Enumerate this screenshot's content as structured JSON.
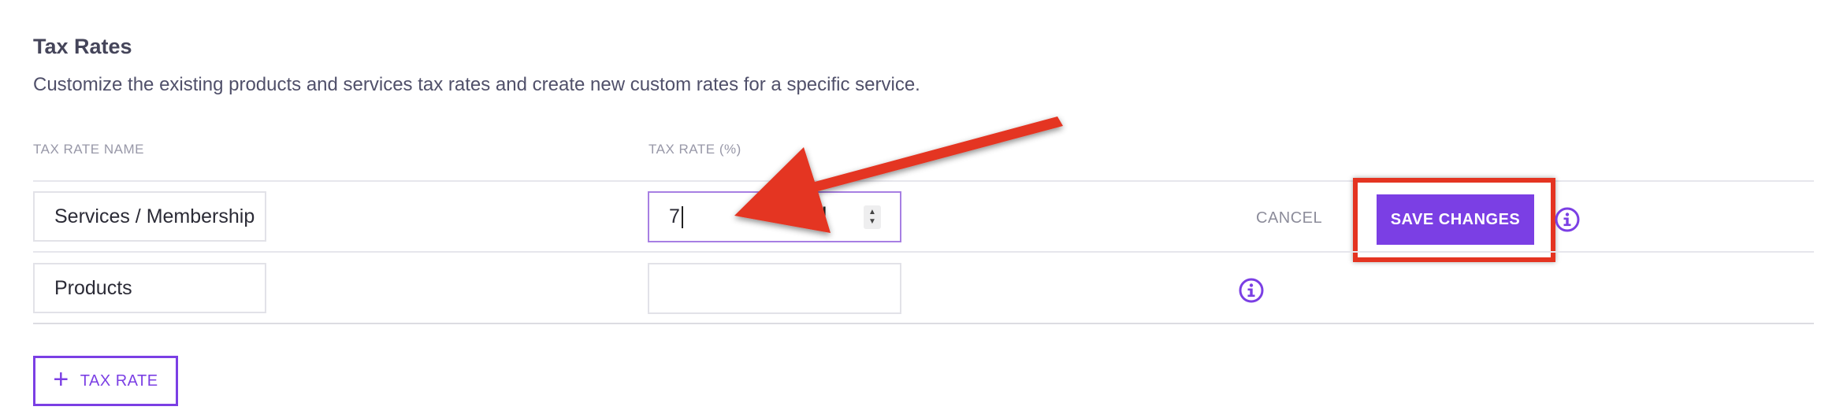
{
  "section": {
    "title": "Tax Rates",
    "description": "Customize the existing products and services tax rates and create new custom rates for a specific service."
  },
  "table": {
    "columns": [
      "TAX RATE NAME",
      "TAX RATE (%)"
    ],
    "rows": [
      {
        "name": "Services / Membership",
        "rate": "7",
        "editing": true
      },
      {
        "name": "Products",
        "rate": "",
        "editing": false
      }
    ]
  },
  "actions": {
    "cancel_label": "CANCEL",
    "save_label": "SAVE CHANGES",
    "add_label": "TAX RATE"
  },
  "colors": {
    "accent": "#7b3fe4",
    "annotation_red": "#e43421"
  },
  "icons": [
    "info-icon",
    "plus-icon",
    "spinner-up-icon",
    "spinner-down-icon",
    "text-cursor-icon",
    "annotation-arrow-icon"
  ]
}
